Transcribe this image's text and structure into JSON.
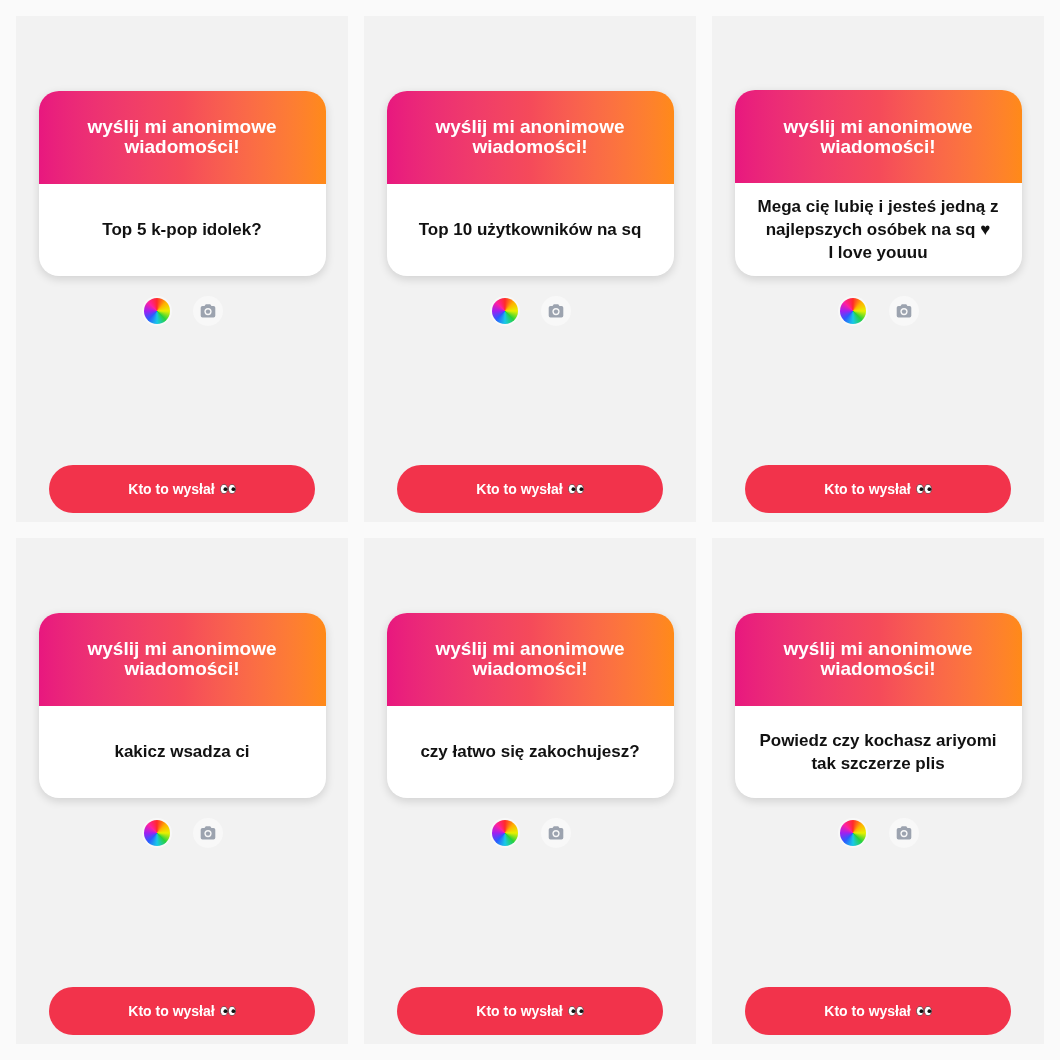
{
  "panels": [
    {
      "header": "wyślij mi anonimowe wiadomości!",
      "message": "Top 5 k-pop idolek?",
      "button": "Kto to wysłał"
    },
    {
      "header": "wyślij mi anonimowe wiadomości!",
      "message": "Top 10 użytkowników na sq",
      "button": "Kto to wysłał"
    },
    {
      "header": "wyślij mi anonimowe wiadomości!",
      "message": "Mega cię lubię i jesteś jedną z najlepszych osóbek na sq ♥\nI love youuu",
      "button": "Kto to wysłał"
    },
    {
      "header": "wyślij mi anonimowe wiadomości!",
      "message": "kakicz wsadza ci",
      "button": "Kto to wysłał"
    },
    {
      "header": "wyślij mi anonimowe wiadomości!",
      "message": "czy łatwo się zakochujesz?",
      "button": "Kto to wysłał"
    },
    {
      "header": "wyślij mi anonimowe wiadomości!",
      "message": "Powiedz czy kochasz ariyomi tak szczerze plis",
      "button": "Kto to wysłał"
    }
  ]
}
